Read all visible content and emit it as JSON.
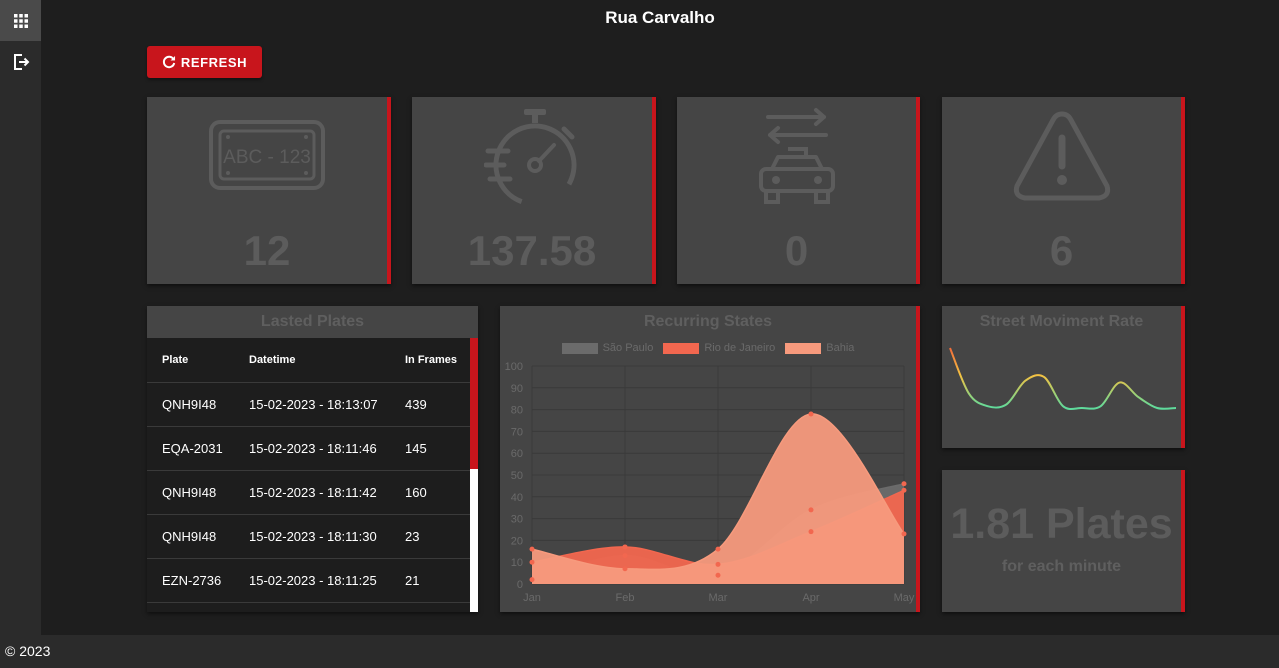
{
  "header": {
    "title": "Rua Carvalho"
  },
  "toolbar": {
    "refresh_label": "REFRESH"
  },
  "kpis": [
    {
      "icon": "license-plate-icon",
      "value": "12",
      "plate_text": "ABC - 123"
    },
    {
      "icon": "stopwatch-icon",
      "value": "137.58"
    },
    {
      "icon": "car-swap-icon",
      "value": "0"
    },
    {
      "icon": "warning-icon",
      "value": "6"
    }
  ],
  "plates": {
    "title": "Lasted Plates",
    "columns": [
      "Plate",
      "Datetime",
      "In Frames"
    ],
    "rows": [
      [
        "QNH9I48",
        "15-02-2023 - 18:13:07",
        "439"
      ],
      [
        "EQA-2031",
        "15-02-2023 - 18:11:46",
        "145"
      ],
      [
        "QNH9I48",
        "15-02-2023 - 18:11:42",
        "160"
      ],
      [
        "QNH9I48",
        "15-02-2023 - 18:11:30",
        "23"
      ],
      [
        "EZN-2736",
        "15-02-2023 - 18:11:25",
        "21"
      ]
    ]
  },
  "chart_data": [
    {
      "type": "area",
      "title": "Recurring States",
      "categories": [
        "Jan",
        "Feb",
        "Mar",
        "Apr",
        "May"
      ],
      "ylim": [
        0,
        100
      ],
      "yticks": [
        "0",
        "10",
        "20",
        "30",
        "40",
        "50",
        "60",
        "70",
        "80",
        "90",
        "100"
      ],
      "grid": true,
      "legend": "top",
      "series": [
        {
          "name": "São Paulo",
          "color": "#6b6b6b",
          "values": [
            2,
            13,
            4,
            34,
            46
          ]
        },
        {
          "name": "Rio de Janeiro",
          "color": "#f2674f",
          "values": [
            10,
            17,
            9,
            24,
            43
          ]
        },
        {
          "name": "Bahia",
          "color": "#f79a7d",
          "values": [
            16,
            7,
            16,
            78,
            23
          ]
        }
      ]
    },
    {
      "type": "line",
      "title": "Street Moviment Rate",
      "values": [
        60,
        35,
        28,
        29,
        42,
        44,
        28,
        27,
        28,
        41,
        33,
        27,
        27
      ],
      "grid": false,
      "legend": "none"
    }
  ],
  "per_minute": {
    "value": "1.81 Plates",
    "label": "for each minute"
  },
  "footer": {
    "text": "© 2023"
  },
  "colors": {
    "accent": "#c8151c",
    "card": "#454545",
    "background": "#1e1e1e"
  }
}
